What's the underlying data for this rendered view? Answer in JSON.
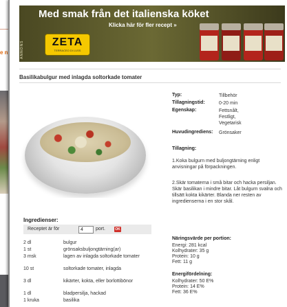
{
  "background": {
    "partial_text": "e n"
  },
  "ad": {
    "side_text": "ANNONS",
    "title": "Med smak från det italienska köket",
    "cta": "Klicka här för fler recept »",
    "logo_name": "ZETA",
    "logo_sub": "TERRACEO DI LUSS",
    "colors": {
      "bg": "#5c5a2a",
      "logo": "#f5c800",
      "jar_red": "#b3241c"
    }
  },
  "recipe": {
    "title": "Basilikabulgur med inlagda soltorkade tomater",
    "info": {
      "typ_label": "Typ:",
      "typ_value": "Tillbehör",
      "tid_label": "Tillagningstid:",
      "tid_value": "0-20 min",
      "egenskap_label": "Egenskap:",
      "egenskap_value": "Fettsnålt, Festligt, Vegetarisk",
      "huvud_label": "Huvudingrediens:",
      "huvud_value": "Grönsaker"
    },
    "tillagning": {
      "heading": "Tillagning:",
      "step1": "1.Koka bulgurn med buljongtärning enligt anvisningar på förpackningen.",
      "step2": "2.Skär tomaterna i små bitar och hacka persiljan. Skär basilikan i mindre bitar. Låt bulgurn svalna och tillsätt kokta kikärter. Blanda ner resten av ingredienserna i en stor skål."
    },
    "naring": {
      "heading": "Näringsvärde per portion:",
      "lines": [
        "Energi: 281 kcal",
        "Kolhydrater: 35 g",
        "Protein: 10 g",
        "Fett: 11 g"
      ]
    },
    "energi": {
      "heading": "Energifördelning:",
      "lines": [
        "Kolhydrater: 50 E%",
        "Protein: 14 E%",
        "Fett: 36 E%"
      ]
    },
    "ingredients": {
      "heading": "Ingredienser:",
      "portions_label": "Receptet är för",
      "portions_value": "4",
      "portions_unit": "port.",
      "ok_label": "OK",
      "rows": [
        {
          "qty": "2 dl",
          "name": "bulgur"
        },
        {
          "qty": "1 st",
          "name": "grönsaksbuljongtärning(ar)"
        },
        {
          "qty": "3 msk",
          "name": "lagen av inlagda soltorkade tomater"
        },
        {
          "qty": "10 st",
          "name": "soltorkade tomater, inlagda"
        },
        {
          "qty": "3 dl",
          "name": "kikärter, kokta, eller borlottibönor"
        },
        {
          "qty": "1 dl",
          "name": "bladpersilja, hackad"
        },
        {
          "qty": "1 kruka",
          "name": "basilika"
        }
      ]
    }
  }
}
